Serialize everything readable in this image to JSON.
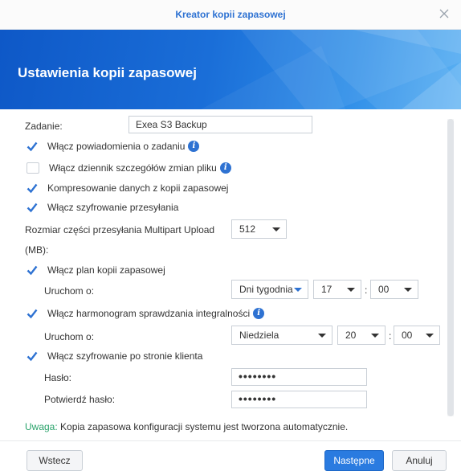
{
  "window": {
    "title": "Kreator kopii zapasowej"
  },
  "banner": {
    "heading": "Ustawienia kopii zapasowej"
  },
  "form": {
    "task_label": "Zadanie:",
    "task_value": "Exea S3 Backup",
    "notify": {
      "label": "Włącz powiadomienia o zadaniu",
      "checked": true
    },
    "change_log": {
      "label": "Włącz dziennik szczegółów zmian pliku",
      "checked": false
    },
    "compress": {
      "label": "Kompresowanie danych z kopii zapasowej",
      "checked": true
    },
    "transfer_encrypt": {
      "label": "Włącz szyfrowanie przesyłania",
      "checked": true
    },
    "multipart": {
      "label_line1": "Rozmiar części przesyłania Multipart Upload",
      "label_line2": "(MB):",
      "value": "512"
    },
    "schedule": {
      "label": "Włącz plan kopii zapasowej",
      "checked": true,
      "run_label": "Uruchom o:",
      "frequency": "Dni tygodnia",
      "hour": "17",
      "minute": "00"
    },
    "integrity": {
      "label": "Włącz harmonogram sprawdzania integralności",
      "checked": true,
      "run_label": "Uruchom o:",
      "day": "Niedziela",
      "hour": "20",
      "minute": "00"
    },
    "client_encrypt": {
      "label": "Włącz szyfrowanie po stronie klienta",
      "checked": true,
      "password_label": "Hasło:",
      "password_value": "••••••••",
      "confirm_label": "Potwierdź hasło:",
      "confirm_value": "••••••••"
    },
    "time_separator": ":"
  },
  "note": {
    "prefix": "Uwaga:",
    "text": " Kopia zapasowa konfiguracji systemu jest tworzona automatycznie."
  },
  "footer": {
    "back": "Wstecz",
    "next": "Następne",
    "cancel": "Anuluj"
  },
  "colors": {
    "accent": "#2e72d2",
    "primary_button": "#2a7be0",
    "note_accent": "#2aa36b"
  }
}
